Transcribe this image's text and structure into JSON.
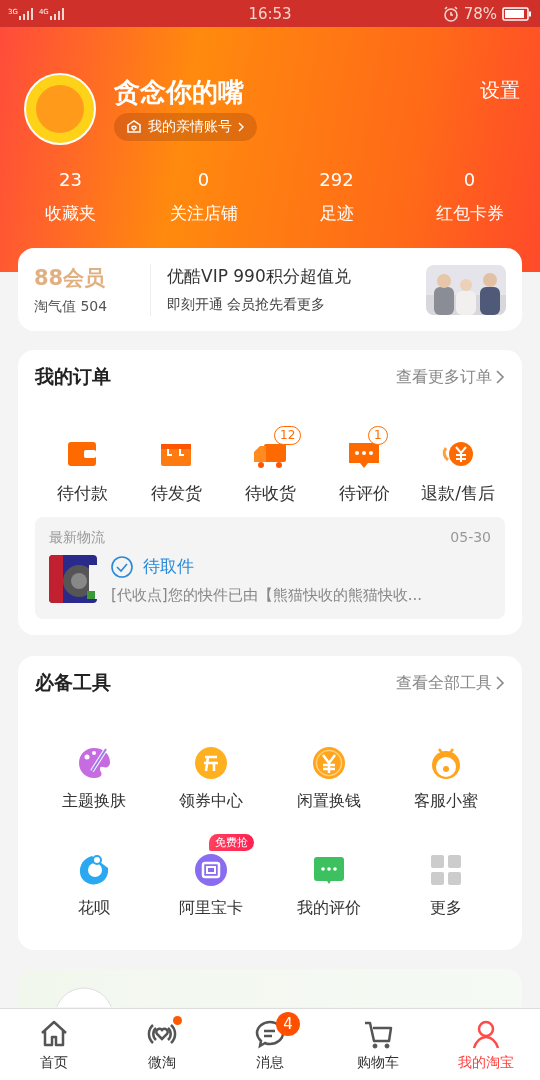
{
  "status_bar": {
    "networks": [
      "3G",
      "4G"
    ],
    "time": "16:53",
    "battery": "78%"
  },
  "profile": {
    "name": "贪念你的嘴",
    "family_account": "我的亲情账号",
    "settings": "设置"
  },
  "stats": [
    {
      "value": "23",
      "label": "收藏夹"
    },
    {
      "value": "0",
      "label": "关注店铺"
    },
    {
      "value": "292",
      "label": "足迹"
    },
    {
      "value": "0",
      "label": "红包卡券"
    }
  ],
  "member": {
    "badge": "88会员",
    "score": "淘气值 504",
    "promo_title": "优酷VIP 990积分超值兑",
    "promo_subtitle": "即刻开通 会员抢先看更多"
  },
  "orders": {
    "title": "我的订单",
    "more": "查看更多订单",
    "items": [
      {
        "label": "待付款"
      },
      {
        "label": "待发货"
      },
      {
        "label": "待收货",
        "badge": "12"
      },
      {
        "label": "待评价",
        "badge": "1"
      },
      {
        "label": "退款/售后"
      }
    ],
    "logistics": {
      "title": "最新物流",
      "date": "05-30",
      "status": "待取件",
      "message": "[代收点]您的快件已由【熊猫快收的熊猫快收..."
    }
  },
  "tools": {
    "title": "必备工具",
    "more": "查看全部工具",
    "items": [
      {
        "label": "主题换肤"
      },
      {
        "label": "领券中心"
      },
      {
        "label": "闲置换钱"
      },
      {
        "label": "客服小蜜"
      },
      {
        "label": "花呗"
      },
      {
        "label": "阿里宝卡",
        "tag": "免费抢"
      },
      {
        "label": "我的评价"
      },
      {
        "label": "更多"
      }
    ]
  },
  "tab_bar": [
    {
      "label": "首页",
      "selected": false,
      "dot": false
    },
    {
      "label": "微淘",
      "selected": false,
      "dot": true
    },
    {
      "label": "消息",
      "selected": false,
      "dot": false,
      "badge": "4"
    },
    {
      "label": "购物车",
      "selected": false,
      "dot": false
    },
    {
      "label": "我的淘宝",
      "selected": true,
      "dot": false
    }
  ]
}
